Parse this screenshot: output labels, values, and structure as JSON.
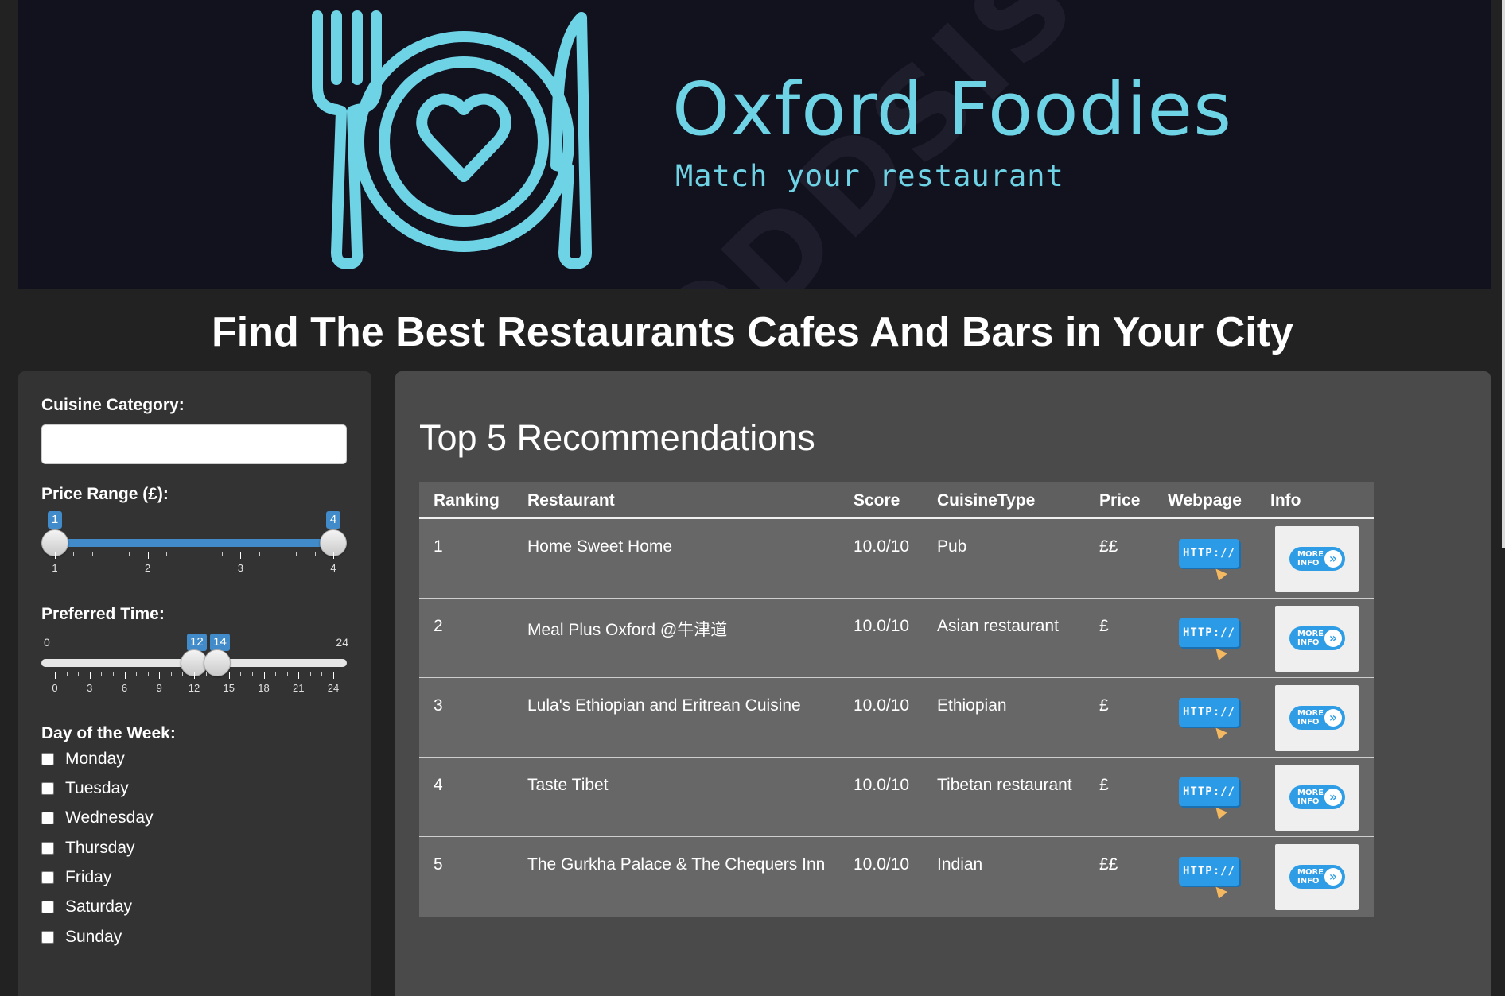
{
  "brand": {
    "title": "Oxford Foodies",
    "subtitle": "Match your restaurant",
    "watermark": "ODDSIS",
    "logo_icon": "fork-plate-heart-knife-icon",
    "accent_color": "#6fd3e6"
  },
  "headline": "Find The Best Restaurants Cafes And Bars in Your City",
  "sidebar": {
    "cuisine_label": "Cuisine Category:",
    "cuisine_value": "",
    "price_label": "Price Range (£):",
    "price": {
      "min": 1,
      "max": 4,
      "from": 1,
      "to": 4,
      "tick_labels": [
        "1",
        "2",
        "3",
        "4"
      ],
      "from_label": "1",
      "to_label": "4"
    },
    "time_label": "Preferred Time:",
    "time": {
      "min": 0,
      "max": 24,
      "from": 12,
      "to": 14,
      "min_label": "0",
      "max_label": "24",
      "tick_labels": [
        "0",
        "3",
        "6",
        "9",
        "12",
        "15",
        "18",
        "21",
        "24"
      ],
      "from_label": "12",
      "to_label": "14"
    },
    "day_label": "Day of the Week:",
    "days": [
      {
        "label": "Monday",
        "checked": false
      },
      {
        "label": "Tuesday",
        "checked": false
      },
      {
        "label": "Wednesday",
        "checked": false
      },
      {
        "label": "Thursday",
        "checked": false
      },
      {
        "label": "Friday",
        "checked": false
      },
      {
        "label": "Saturday",
        "checked": false
      },
      {
        "label": "Sunday",
        "checked": false
      }
    ],
    "slider_color": "#428bca"
  },
  "main": {
    "title": "Top 5 Recommendations",
    "columns": [
      "Ranking",
      "Restaurant",
      "Score",
      "CuisineType",
      "Price",
      "Webpage",
      "Info"
    ],
    "webpage_button": "HTTP://",
    "info_button": "MORE INFO",
    "rows": [
      {
        "ranking": "1",
        "restaurant": "Home Sweet Home",
        "score": "10.0/10",
        "cuisine": "Pub",
        "price": "££"
      },
      {
        "ranking": "2",
        "restaurant": "Meal Plus Oxford @牛津道",
        "score": "10.0/10",
        "cuisine": "Asian restaurant",
        "price": "£"
      },
      {
        "ranking": "3",
        "restaurant": "Lula's Ethiopian and Eritrean Cuisine",
        "score": "10.0/10",
        "cuisine": "Ethiopian",
        "price": "£"
      },
      {
        "ranking": "4",
        "restaurant": "Taste Tibet",
        "score": "10.0/10",
        "cuisine": "Tibetan restaurant",
        "price": "£"
      },
      {
        "ranking": "5",
        "restaurant": "The Gurkha Palace & The Chequers Inn",
        "score": "10.0/10",
        "cuisine": "Indian",
        "price": "££"
      }
    ]
  }
}
